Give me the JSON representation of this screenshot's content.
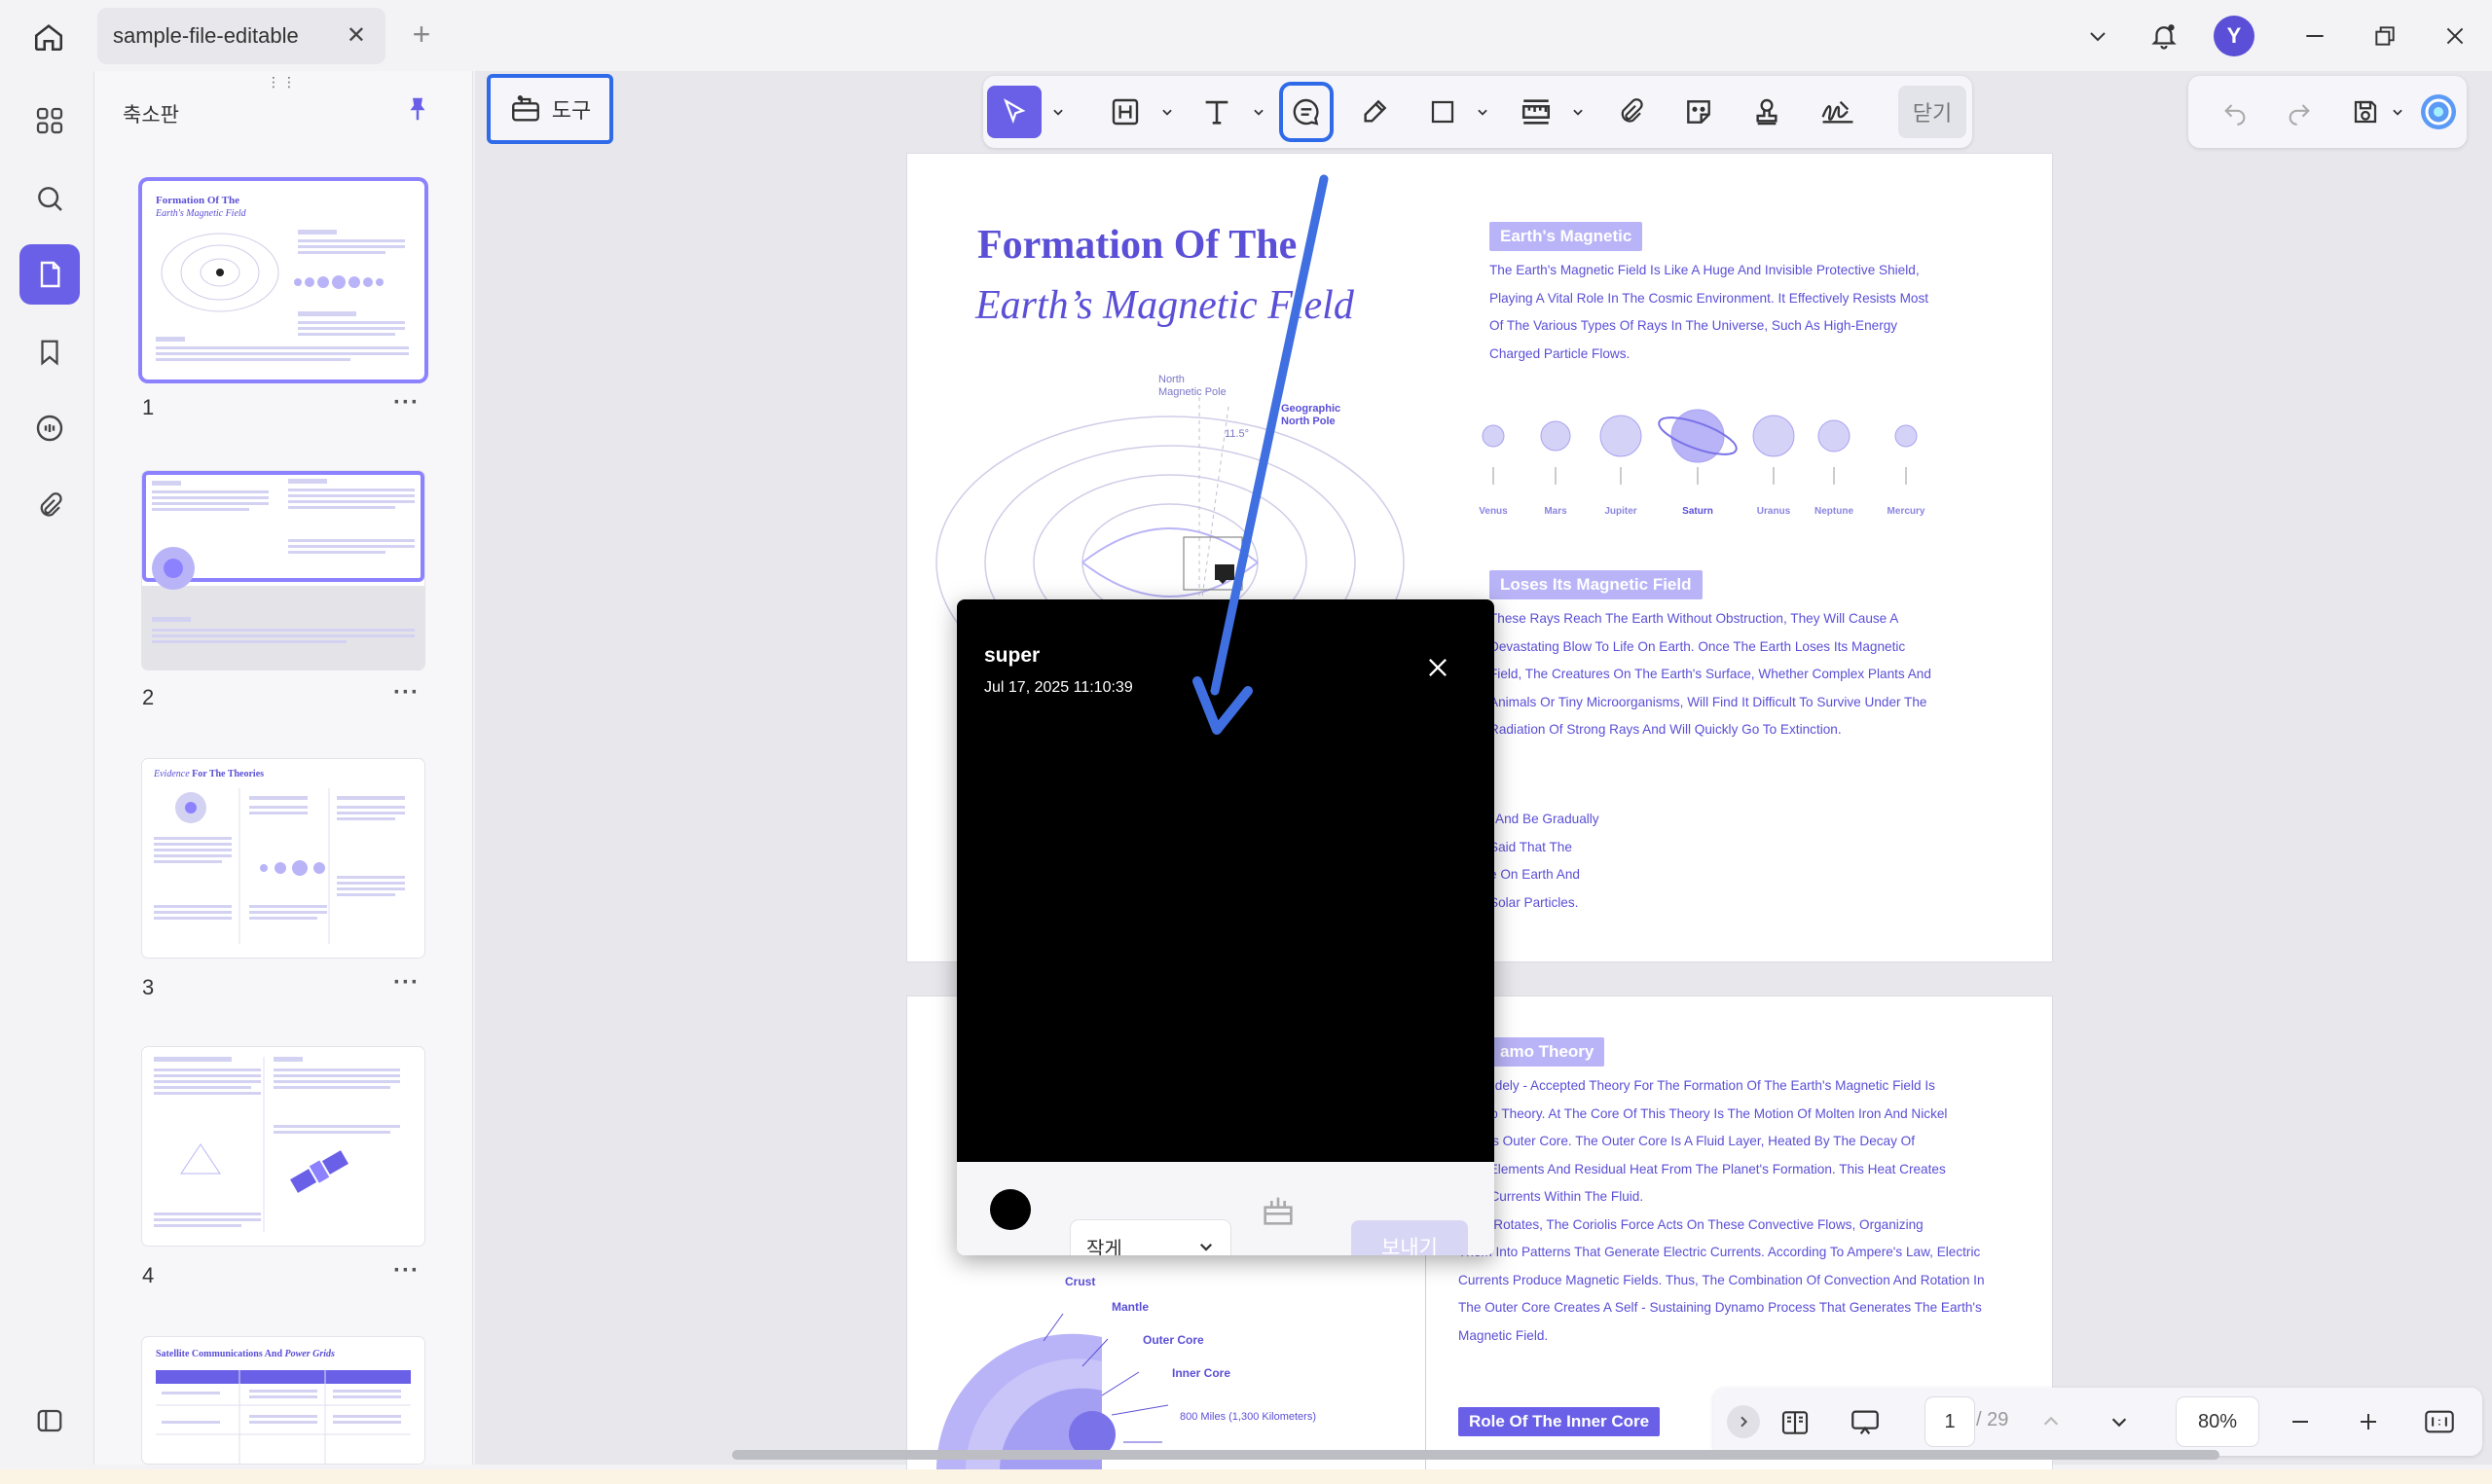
{
  "tab": {
    "title": "sample-file-editable",
    "new_tab": "+",
    "close": "✕"
  },
  "user": {
    "initial": "Y"
  },
  "sidebar": {
    "title": "축소판",
    "pages": [
      {
        "number": "1",
        "more": "···"
      },
      {
        "number": "2",
        "more": "···"
      },
      {
        "number": "3",
        "more": "···"
      },
      {
        "number": "4",
        "more": "···"
      }
    ],
    "thumb_texts": {
      "p1_title_a": "Formation Of The",
      "p1_title_b": "Earth's Magnetic Field",
      "p3_title_a": "Evidence",
      "p3_title_b": "For The Theories",
      "p5_title_a": "Satellite Communications And",
      "p5_title_b": "Power Grids"
    }
  },
  "toolbar": {
    "tools_label": "도구",
    "close_label": "닫기"
  },
  "page1": {
    "title_line1": "Formation Of The",
    "title_line2": "Earth’s Magnetic Field",
    "diagram_labels": {
      "north_magnetic": "North\nMagnetic Pole",
      "geographic": "Geographic\nNorth Pole",
      "angle": "11.5°"
    },
    "section1_tag": "Earth's Magnetic",
    "section1_lines": [
      "The Earth's Magnetic Field Is Like A Huge And Invisible Protective Shield,",
      "Playing A Vital Role In The Cosmic Environment. It Effectively Resists Most",
      "Of The Various Types Of Rays In The Universe, Such As High-Energy",
      "Charged Particle Flows."
    ],
    "planets": [
      "Venus",
      "Mars",
      "Jupiter",
      "Saturn",
      "Uranus",
      "Neptune",
      "Mercury"
    ],
    "section2_tag": "Loses Its Magnetic Field",
    "section2_lines": [
      "These Rays Reach The Earth Without Obstruction, They Will Cause A",
      "Devastating Blow To Life On Earth. Once The Earth Loses Its Magnetic",
      "Field, The Creatures On The Earth's Surface, Whether Complex Plants And",
      "Animals Or Tiny Microorganisms, Will Find It Difficult To Survive Under The",
      "Radiation Of Strong Rays And Will Quickly Go To Extinction."
    ],
    "section3_lines": [
      "l And Be Gradually",
      "Said That The",
      "e On Earth And",
      "Solar Particles."
    ]
  },
  "page2": {
    "section_tag": "amo Theory",
    "lines": [
      "ost Widely - Accepted Theory For The Formation Of The Earth's Magnetic Field Is",
      "ynamo Theory. At The Core Of This Theory Is The Motion Of Molten Iron And Nickel",
      "Earth's Outer Core. The Outer Core Is A Fluid Layer, Heated By The Decay Of",
      "ctive Elements And Residual Heat From The Planet's Formation. This Heat Creates",
      "ction Currents Within The Fluid.",
      "Earth Rotates, The Coriolis Force Acts On These Convective Flows, Organizing",
      "Them Into Patterns That Generate Electric Currents. According To Ampere's Law, Electric",
      "Currents Produce Magnetic Fields. Thus, The Combination Of Convection And Rotation In",
      "The Outer Core Creates A Self - Sustaining Dynamo Process That Generates The Earth's",
      "Magnetic Field."
    ],
    "inner_core_tag": "Role Of The Inner Core",
    "layer_labels": [
      "Crust",
      "Mantle",
      "Outer Core",
      "Inner Core"
    ],
    "distance_label": "800 Miles (1,300 Kilometers)"
  },
  "comment": {
    "author": "super",
    "timestamp": "Jul 17, 2025 11:10:39",
    "size_option": "작게",
    "send_label": "보내기",
    "color": "#000000"
  },
  "navigation": {
    "current_page": "1",
    "total_pages": "/ 29",
    "zoom": "80%"
  },
  "colors": {
    "accent": "#6a60e8",
    "highlight_box": "#2f6be8",
    "doc_purple": "#5a4fd6",
    "arrow_blue": "#3f6fe0"
  }
}
